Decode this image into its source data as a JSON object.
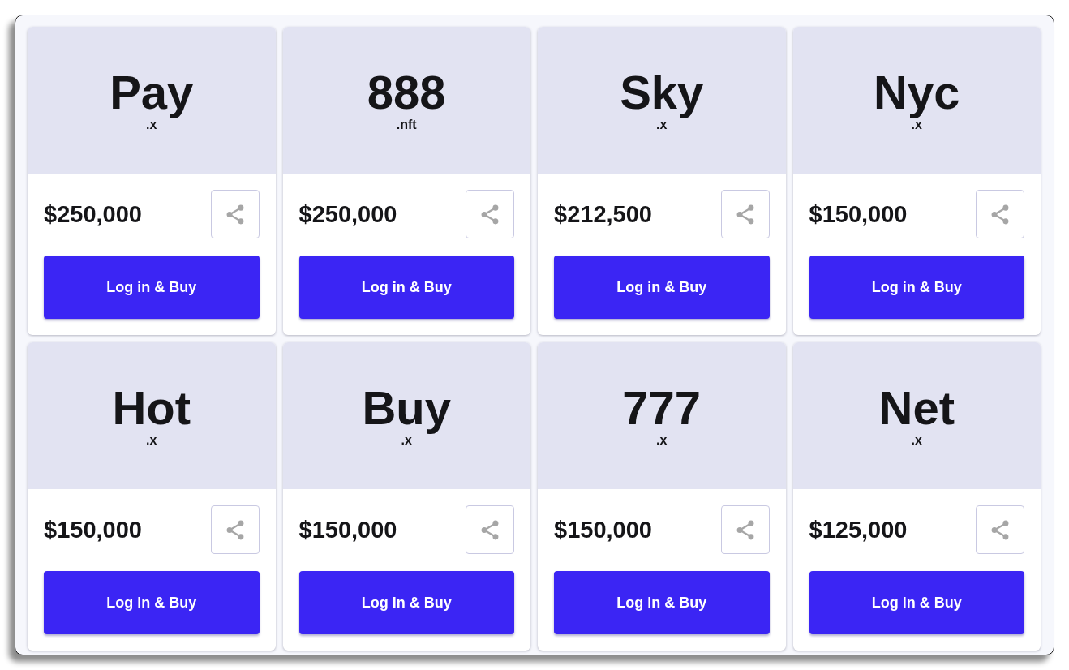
{
  "listings": [
    {
      "name": "Pay",
      "extension": ".x",
      "price": "$250,000",
      "button": "Log in & Buy"
    },
    {
      "name": "888",
      "extension": ".nft",
      "price": "$250,000",
      "button": "Log in & Buy"
    },
    {
      "name": "Sky",
      "extension": ".x",
      "price": "$212,500",
      "button": "Log in & Buy"
    },
    {
      "name": "Nyc",
      "extension": ".x",
      "price": "$150,000",
      "button": "Log in & Buy"
    },
    {
      "name": "Hot",
      "extension": ".x",
      "price": "$150,000",
      "button": "Log in & Buy"
    },
    {
      "name": "Buy",
      "extension": ".x",
      "price": "$150,000",
      "button": "Log in & Buy"
    },
    {
      "name": "777",
      "extension": ".x",
      "price": "$150,000",
      "button": "Log in & Buy"
    },
    {
      "name": "Net",
      "extension": ".x",
      "price": "$125,000",
      "button": "Log in & Buy"
    }
  ]
}
